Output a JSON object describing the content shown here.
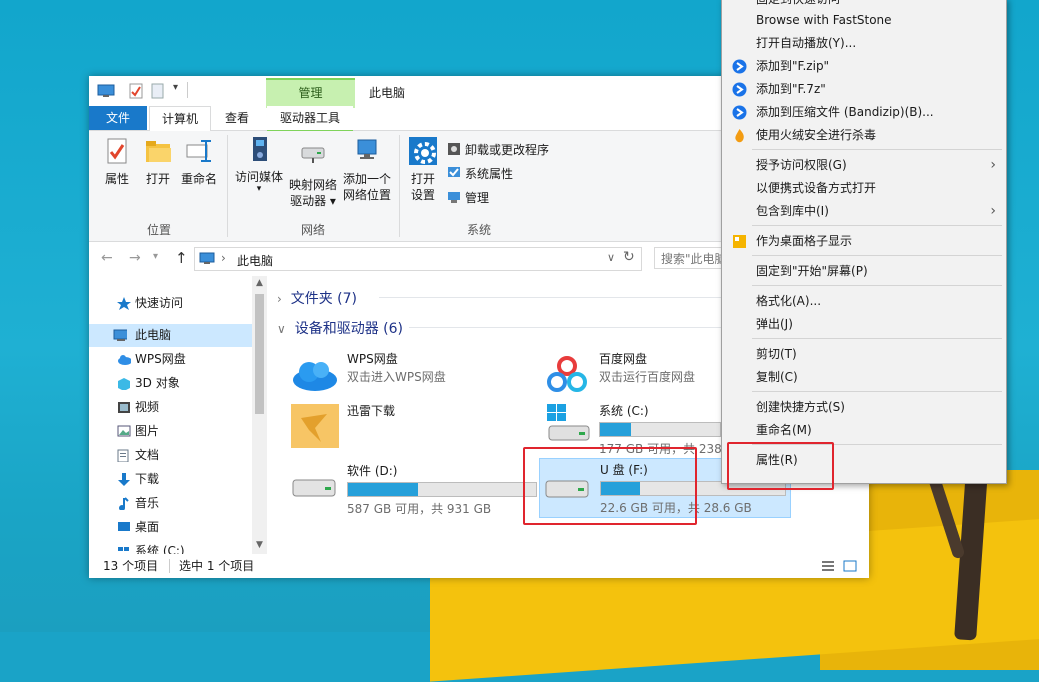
{
  "window": {
    "title": "此电脑",
    "context_tab_label": "管理",
    "quick_access_toolbar": [
      "properties-icon",
      "new-folder-icon",
      "dropdown-icon"
    ]
  },
  "ribbon_tabs": {
    "file": "文件",
    "computer": "计算机",
    "view": "查看",
    "drive_tools": "驱动器工具"
  },
  "ribbon": {
    "location": {
      "label": "位置",
      "buttons": [
        "属性",
        "打开",
        "重命名"
      ]
    },
    "network": {
      "label": "网络",
      "access_media": "访问媒体",
      "map_drive": "映射网络\n驱动器",
      "map_drive_l1": "映射网络",
      "map_drive_l2": "驱动器",
      "add_location_l1": "添加一个",
      "add_location_l2": "网络位置"
    },
    "system": {
      "label": "系统",
      "open_settings_l1": "打开",
      "open_settings_l2": "设置",
      "uninstall": "卸载或更改程序",
      "system_properties": "系统属性",
      "manage": "管理"
    }
  },
  "address": {
    "path": "此电脑",
    "search_placeholder": "搜索\"此电脑\""
  },
  "nav": {
    "items": [
      "快速访问",
      "此电脑",
      "WPS网盘",
      "3D 对象",
      "视频",
      "图片",
      "文档",
      "下载",
      "音乐",
      "桌面",
      "系统 (C:)"
    ]
  },
  "content": {
    "folders_header": "文件夹 (7)",
    "devices_header": "设备和驱动器 (6)",
    "items": [
      {
        "name": "WPS网盘",
        "sub": "双击进入WPS网盘"
      },
      {
        "name": "百度网盘",
        "sub": "双击运行百度网盘"
      },
      {
        "name": "迅雷下载",
        "sub": ""
      },
      {
        "name": "系统 (C:)",
        "sub": "177 GB 可用，共 238",
        "used_fraction": 0.26
      },
      {
        "name": "软件 (D:)",
        "sub": "587 GB 可用，共 931 GB",
        "used_fraction": 0.37
      },
      {
        "name": "U 盘 (F:)",
        "sub": "22.6 GB 可用，共 28.6 GB",
        "used_fraction": 0.21
      }
    ]
  },
  "status": {
    "count": "13 个项目",
    "selected": "选中 1 个项目"
  },
  "menu": {
    "items": [
      "固定到快速访问",
      "Browse with FastStone",
      "打开自动播放(Y)...",
      "添加到\"F.zip\"",
      "添加到\"F.7z\"",
      "添加到压缩文件 (Bandizip)(B)...",
      "使用火绒安全进行杀毒",
      "授予访问权限(G)",
      "以便携式设备方式打开",
      "包含到库中(I)",
      "作为桌面格子显示",
      "固定到\"开始\"屏幕(P)",
      "格式化(A)...",
      "弹出(J)",
      "剪切(T)",
      "复制(C)",
      "创建快捷方式(S)",
      "重命名(M)",
      "属性(R)"
    ]
  },
  "colors": {
    "accent": "#1979ca",
    "highlight_red": "#e0252e",
    "selected_bg": "#cce8ff",
    "bar_fill": "#26a0da"
  }
}
